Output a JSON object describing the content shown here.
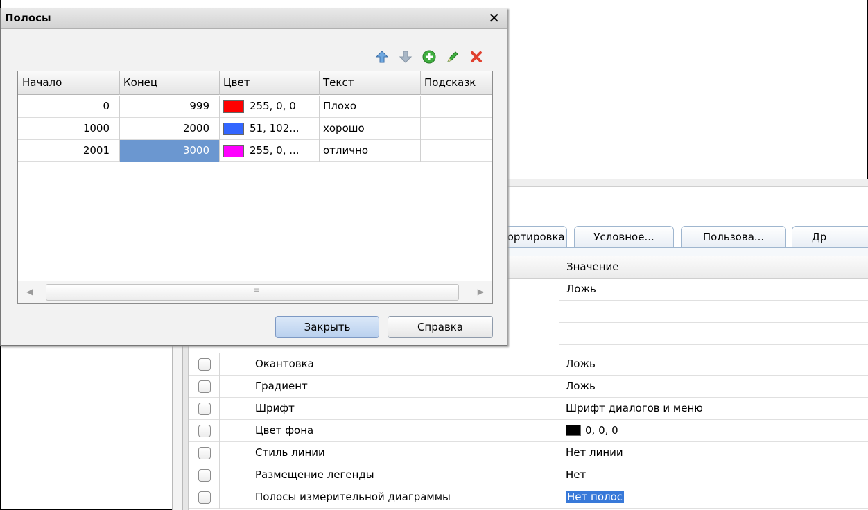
{
  "dialog": {
    "title": "Полосы",
    "close_glyph": "✕",
    "toolbar": {
      "icons": [
        "arrow-up-icon",
        "arrow-down-icon",
        "add-icon",
        "edit-icon",
        "delete-icon"
      ]
    },
    "columns": [
      "Начало",
      "Конец",
      "Цвет",
      "Текст",
      "Подсказк"
    ],
    "rows": [
      {
        "start": "0",
        "end": "999",
        "color_hex": "#ff0000",
        "color_text": "255, 0, 0",
        "text": "Плохо",
        "hint": ""
      },
      {
        "start": "1000",
        "end": "2000",
        "color_hex": "#3366ff",
        "color_text": "51, 102...",
        "text": "хорошо",
        "hint": ""
      },
      {
        "start": "2001",
        "end": "3000",
        "color_hex": "#ff00ff",
        "color_text": "255, 0, ...",
        "text": "отлично",
        "hint": ""
      }
    ],
    "buttons": {
      "close": "Закрыть",
      "help": "Справка"
    }
  },
  "tabs": [
    "Сортировка",
    "Условное...",
    "Пользова...",
    "Др"
  ],
  "properties": {
    "value_header": "Значение",
    "top_values": [
      "Ложь",
      "",
      ""
    ],
    "rows": [
      {
        "name": "Окантовка",
        "value": "Ложь"
      },
      {
        "name": "Градиент",
        "value": "Ложь"
      },
      {
        "name": "Шрифт",
        "value": "Шрифт диалогов и меню"
      },
      {
        "name": "Цвет фона",
        "value": "0, 0, 0",
        "swatch": "#000000"
      },
      {
        "name": "Стиль линии",
        "value": "Нет линии"
      },
      {
        "name": "Размещение легенды",
        "value": "Нет"
      },
      {
        "name": "Полосы измерительной диаграммы",
        "value": "Нет полос",
        "selected": true
      }
    ]
  },
  "colors": {
    "selection": "#6b97d0",
    "value_selection": "#3879d9"
  }
}
